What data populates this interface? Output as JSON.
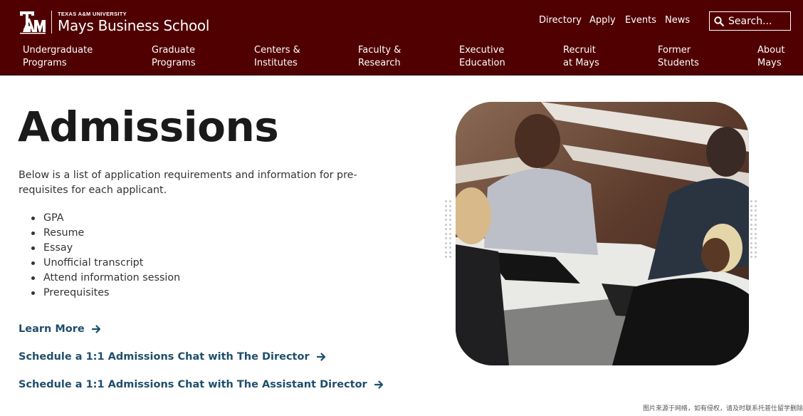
{
  "header": {
    "university": "TEXAS A&M UNIVERSITY",
    "school": "Mays Business School",
    "utility_links": [
      "Directory",
      "Apply",
      "Events",
      "News"
    ],
    "search_placeholder": "Search...",
    "nav": [
      {
        "line1": "Undergraduate",
        "line2": "Programs"
      },
      {
        "line1": "Graduate",
        "line2": "Programs"
      },
      {
        "line1": "Centers &",
        "line2": "Institutes"
      },
      {
        "line1": "Faculty &",
        "line2": "Research"
      },
      {
        "line1": "Executive",
        "line2": "Education"
      },
      {
        "line1": "Recruit",
        "line2": "at Mays"
      },
      {
        "line1": "Former",
        "line2": "Students"
      },
      {
        "line1": "About",
        "line2": "Mays"
      }
    ]
  },
  "main": {
    "title": "Admissions",
    "intro": "Below is a list of application requirements and information for pre-requisites for each applicant.",
    "requirements": [
      "GPA",
      "Resume",
      "Essay",
      "Unofficial transcript",
      "Attend information session",
      "Prerequisites"
    ],
    "links": [
      "Learn More",
      "Schedule a 1:1 Admissions Chat with The Director",
      "Schedule a 1:1 Admissions Chat with The Assistant Director"
    ]
  },
  "watermark": "图片来源于网络，如有侵权，请及时联系托普仕留学删除",
  "colors": {
    "maroon": "#500000",
    "link": "#1f4e6b"
  }
}
